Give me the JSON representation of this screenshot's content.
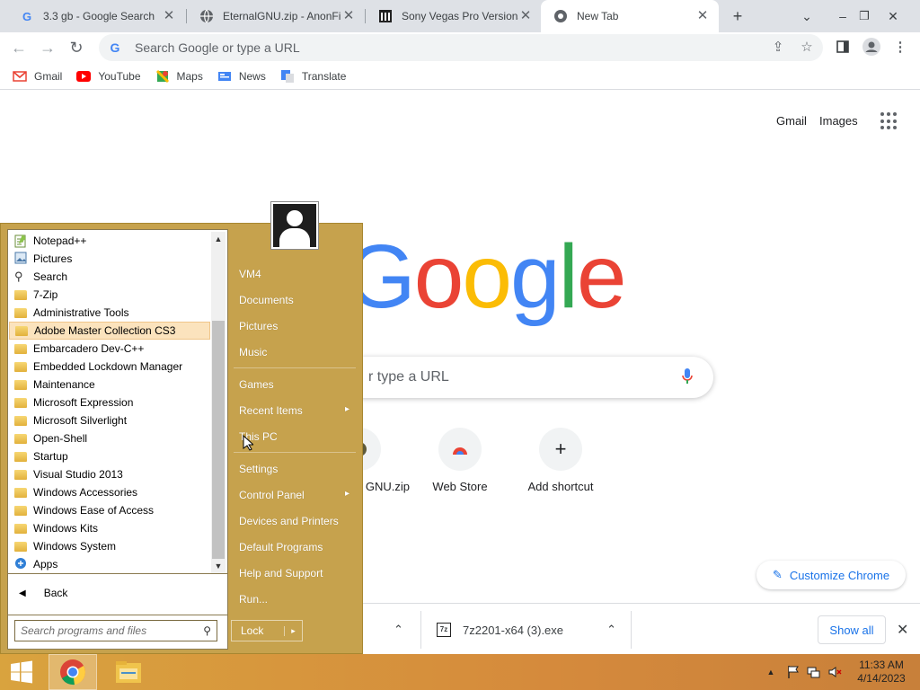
{
  "tabs": [
    {
      "title": "3.3 gb - Google Search",
      "icon": "google-g-icon"
    },
    {
      "title": "EternalGNU.zip - AnonFil",
      "icon": "globe-icon"
    },
    {
      "title": "Sony Vegas Pro Versions",
      "icon": "archive-icon"
    },
    {
      "title": "New Tab",
      "icon": "chrome-icon"
    }
  ],
  "omnibox": {
    "placeholder": "Search Google or type a URL"
  },
  "bookmarks": [
    {
      "label": "Gmail",
      "icon": "gmail-icon"
    },
    {
      "label": "YouTube",
      "icon": "youtube-icon"
    },
    {
      "label": "Maps",
      "icon": "maps-icon"
    },
    {
      "label": "News",
      "icon": "news-icon"
    },
    {
      "label": "Translate",
      "icon": "translate-icon"
    }
  ],
  "ntp": {
    "gmail": "Gmail",
    "images": "Images",
    "logo": [
      "G",
      "o",
      "o",
      "g",
      "l",
      "e"
    ],
    "logo_colors": [
      "#4285f4",
      "#ea4335",
      "#fbbc05",
      "#4285f4",
      "#34a853",
      "#ea4335"
    ],
    "search_placeholder_visible": "r type a URL",
    "shortcuts": [
      {
        "label": "EternalGNU.zip",
        "visible_label": "GNU.zip"
      },
      {
        "label": "Web Store"
      },
      {
        "label": "Add shortcut"
      }
    ],
    "customize": "Customize Chrome"
  },
  "downloads": {
    "items": [
      {
        "name": "7z2201-x64 (3).exe"
      }
    ],
    "show_all": "Show all"
  },
  "start_menu": {
    "programs": [
      {
        "label": "Notepad++",
        "icon": "notepad-icon"
      },
      {
        "label": "Pictures",
        "icon": "pictures-icon"
      },
      {
        "label": "Search",
        "icon": "search-icon"
      },
      {
        "label": "7-Zip",
        "icon": "folder-icon"
      },
      {
        "label": "Administrative Tools",
        "icon": "folder-icon"
      },
      {
        "label": "Adobe Master Collection CS3",
        "icon": "folder-icon"
      },
      {
        "label": "Embarcadero Dev-C++",
        "icon": "folder-icon"
      },
      {
        "label": "Embedded Lockdown Manager",
        "icon": "folder-icon"
      },
      {
        "label": "Maintenance",
        "icon": "folder-icon"
      },
      {
        "label": "Microsoft Expression",
        "icon": "folder-icon"
      },
      {
        "label": "Microsoft Silverlight",
        "icon": "folder-icon"
      },
      {
        "label": "Open-Shell",
        "icon": "folder-icon"
      },
      {
        "label": "Startup",
        "icon": "folder-icon"
      },
      {
        "label": "Visual Studio 2013",
        "icon": "folder-icon"
      },
      {
        "label": "Windows Accessories",
        "icon": "folder-icon"
      },
      {
        "label": "Windows Ease of Access",
        "icon": "folder-icon"
      },
      {
        "label": "Windows Kits",
        "icon": "folder-icon"
      },
      {
        "label": "Windows System",
        "icon": "folder-icon"
      },
      {
        "label": "Apps",
        "icon": "apps-icon"
      }
    ],
    "selected_program": "Adobe Master Collection CS3",
    "back": "Back",
    "search_placeholder": "Search programs and files",
    "right_items": [
      "VM4",
      "Documents",
      "Pictures",
      "Music",
      "Games",
      "Recent Items",
      "This PC",
      "Settings",
      "Control Panel",
      "Devices and Printers",
      "Default Programs",
      "Help and Support",
      "Run..."
    ],
    "lock": "Lock",
    "theme_color": "#c6a24d"
  },
  "taskbar": {
    "time": "11:33 AM",
    "date": "4/14/2023",
    "color": "#d58a3c"
  }
}
